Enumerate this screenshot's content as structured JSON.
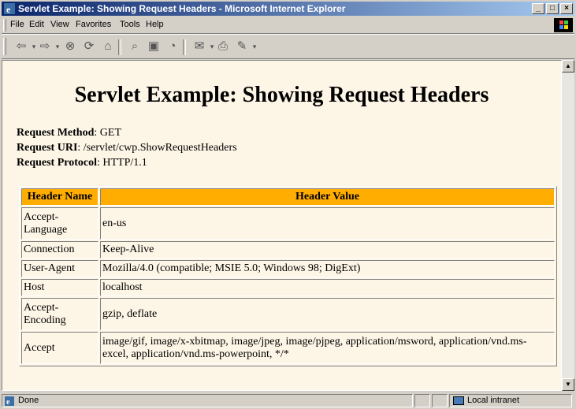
{
  "window": {
    "title": "Servlet Example: Showing Request Headers - Microsoft Internet Explorer"
  },
  "menu": [
    "File",
    "Edit",
    "View",
    "Favorites",
    "Tools",
    "Help"
  ],
  "toolbar_icons": [
    "back-icon",
    "forward-icon",
    "stop-icon",
    "refresh-icon",
    "home-icon",
    "search-icon",
    "favorites-icon",
    "history-icon",
    "mail-icon",
    "print-icon",
    "edit-icon"
  ],
  "page": {
    "heading": "Servlet Example: Showing Request Headers",
    "request_method_label": "Request Method",
    "request_method_value": ": GET",
    "request_uri_label": "Request URI",
    "request_uri_value": ": /servlet/cwp.ShowRequestHeaders",
    "request_protocol_label": "Request Protocol",
    "request_protocol_value": ": HTTP/1.1",
    "table_headers": [
      "Header Name",
      "Header Value"
    ],
    "rows": [
      {
        "name": "Accept-Language",
        "value": "en-us"
      },
      {
        "name": "Connection",
        "value": "Keep-Alive"
      },
      {
        "name": "User-Agent",
        "value": "Mozilla/4.0 (compatible; MSIE 5.0; Windows 98; DigExt)"
      },
      {
        "name": "Host",
        "value": "localhost"
      },
      {
        "name": "Accept-Encoding",
        "value": "gzip, deflate"
      },
      {
        "name": "Accept",
        "value": "image/gif, image/x-xbitmap, image/jpeg, image/pjpeg, application/msword, application/vnd.ms-excel, application/vnd.ms-powerpoint, */*"
      }
    ]
  },
  "status": {
    "text": "Done",
    "zone": "Local intranet"
  },
  "colors": {
    "title_bar": "#0a246a",
    "page_bg": "#fdf5e6",
    "table_header_bg": "#ffad00"
  }
}
